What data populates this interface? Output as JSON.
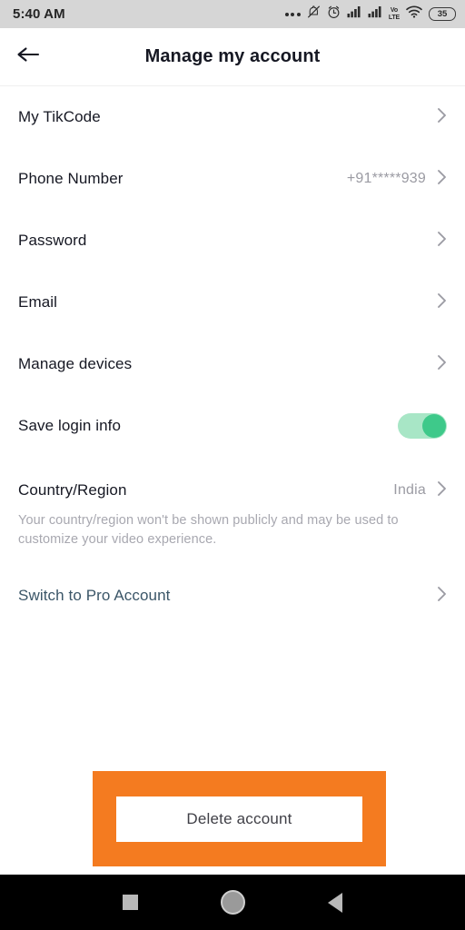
{
  "status_bar": {
    "time": "5:40 AM",
    "battery_level": "35",
    "volte_line1": "Vo",
    "volte_line2": "LTE",
    "icons": [
      "more-dots-icon",
      "bell-muted-icon",
      "alarm-clock-icon",
      "signal-bars-icon",
      "signal-bars-icon",
      "volte-icon",
      "wifi-icon",
      "battery-icon"
    ],
    "background": "#d6d6d6"
  },
  "header": {
    "title": "Manage my account",
    "back_icon": "arrow-left-icon"
  },
  "list": {
    "items": [
      {
        "label": "My TikCode",
        "value": "",
        "type": "chevron"
      },
      {
        "label": "Phone Number",
        "value": "+91*****939",
        "type": "chevron"
      },
      {
        "label": "Password",
        "value": "",
        "type": "chevron"
      },
      {
        "label": "Email",
        "value": "",
        "type": "chevron"
      },
      {
        "label": "Manage devices",
        "value": "",
        "type": "chevron"
      },
      {
        "label": "Save login info",
        "value": "",
        "type": "toggle",
        "toggle_on": true
      }
    ]
  },
  "country": {
    "label": "Country/Region",
    "value": "India",
    "description": "Your country/region won't be shown publicly and may be used to customize your video experience."
  },
  "pro": {
    "label": "Switch to Pro Account",
    "color": "#3b5668"
  },
  "delete": {
    "label": "Delete account",
    "annotation_color": "#f47b20"
  },
  "navbar": {
    "recents_icon": "square-icon",
    "home_icon": "circle-icon",
    "back_icon": "triangle-left-icon"
  },
  "colors": {
    "toggle_on": "#3ec98a",
    "toggle_track": "#a8e6c6",
    "text_primary": "#161823",
    "text_muted": "#9b9ba3"
  }
}
